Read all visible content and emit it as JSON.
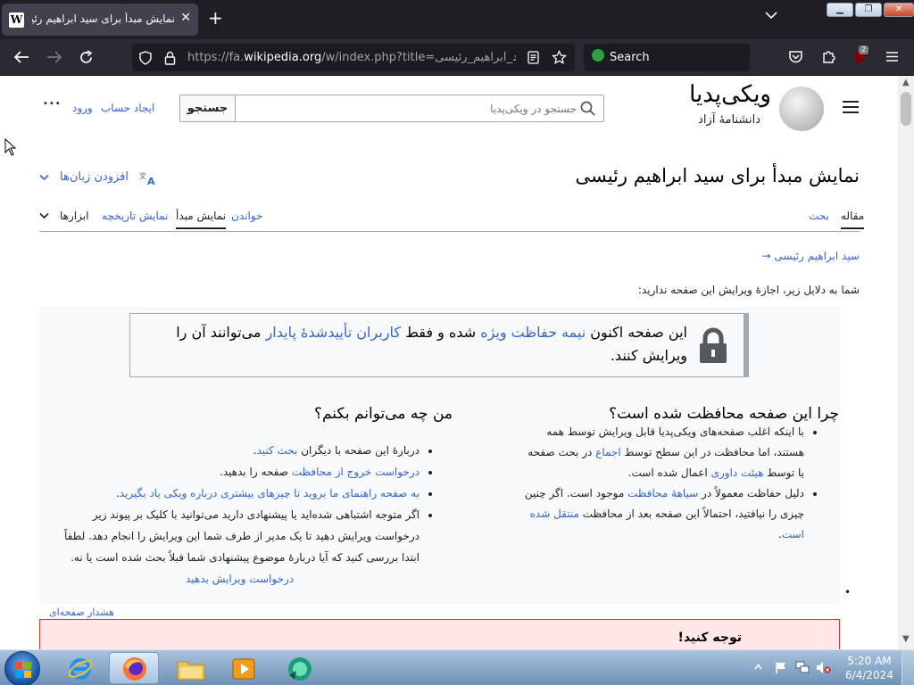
{
  "browser": {
    "tab_title": "نمایش مبدأ برای سید ابراهیم رئیسی",
    "tab_close": "✕",
    "favicon": "W",
    "new_tab": "+",
    "url_prefix": "https://fa.",
    "url_host": "wikipedia.org",
    "url_path": "/w/index.php?title=سید_ابراهیم_رئیسی&ac",
    "search_placeholder": "Search",
    "ext_badge": "2"
  },
  "site": {
    "logo_title": "ویکی‌پدیا",
    "logo_subtitle": "دانشنامهٔ آزاد",
    "search_placeholder": "جستجو در ویکی‌پدیا",
    "search_button": "جستجو",
    "create_account": "ایجاد حساب",
    "login": "ورود",
    "more_dots": "•••"
  },
  "page": {
    "title": "نمایش مبدأ برای سید ابراهیم رئیسی",
    "add_languages": "افزودن زبان‌ها",
    "tabs": {
      "article": "مقاله",
      "talk": "بحث",
      "read": "خواندن",
      "view_source": "نمایش مبدأ",
      "history": "نمایش تاریخچه",
      "tools": "ابزارها"
    },
    "back_link": "→ سید ابراهیم رئیسی",
    "notice": "شما به دلایل زیر، اجازهٔ ویرایش این صفحه ندارید:",
    "protection": {
      "p1": "این صفحه اکنون ",
      "link1": "نیمه حفاظت ویژه",
      "p2": " شده و فقط ",
      "link2": "کاربران تأییدشدهٔ پایدار",
      "p3": " می‌توانند آن را ویرایش کنند."
    },
    "why": {
      "heading": "چرا این صفحه محافظت شده است؟",
      "b1_a": "با اینکه اغلب صفحه‌های ویکی‌پدیا قابل ویرایش توسط همه هستند، اما محافظت در این سطح توسط ",
      "b1_link1": "اجماع",
      "b1_b": " در بحث صفحه یا توسط ",
      "b1_link2": "هیئت داوری",
      "b1_c": " اعمال شده است.",
      "b2_a": "دلیل حفاظت معمولاً در ",
      "b2_link1": "سیاههٔ محافظت",
      "b2_b": " موجود است. اگر چنین چیزی را نیافتید، احتمالاً این صفحه بعد از محافظت ",
      "b2_link2": "منتقل شده است",
      "b2_c": "."
    },
    "what": {
      "heading": "من چه می‌توانم بکنم؟",
      "b1_a": "دربارهٔ این صفحه با دیگران ",
      "b1_link": "بحث کنید",
      "b1_b": ".",
      "b2_link": "درخواست خروج از محافظت",
      "b2_b": " صفحه را بدهید.",
      "b3_link": "به صفحه راهنمای ما بروید تا چیزهای بیشتری درباره ویکی یاد بگیرید",
      "b3_b": ".",
      "b4": "اگر متوجه اشتباهی شده‌اید یا پیشنهادی دارید می‌توانید با کلیک بر پیوند زیر درخواست ویرایش دهید تا یک مدیر از طرف شما این ویرایش را انجام دهد. لطفاً ابتدا بررسی کنید که آیا دربارهٔ موضوع پیشنهادی شما قبلاً بحث شده است یا نه.",
      "request_edit": "درخواست ویرایش بدهید"
    },
    "page_warning_link": "هشدار صفحه‌ای",
    "attention": "توجه کنید!"
  },
  "taskbar": {
    "time": "5:20 AM",
    "date": "6/4/2024"
  },
  "colors": {
    "link": "#3366cc",
    "browser_dark": "#2b2a33",
    "protection_box": "#f8f9fa",
    "warning_box": "#fee7e6"
  }
}
